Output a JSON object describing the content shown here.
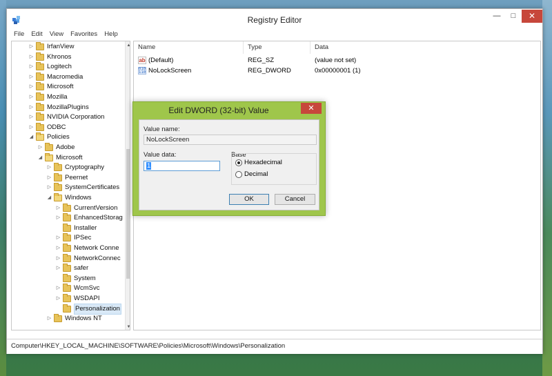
{
  "window": {
    "title": "Registry Editor",
    "controls": {
      "minimize": "—",
      "maximize": "□",
      "close": "✕"
    }
  },
  "menu": [
    "File",
    "Edit",
    "View",
    "Favorites",
    "Help"
  ],
  "tree": [
    {
      "label": "IrfanView",
      "indent": 1,
      "expander": "▷"
    },
    {
      "label": "Khronos",
      "indent": 1,
      "expander": "▷"
    },
    {
      "label": "Logitech",
      "indent": 1,
      "expander": "▷"
    },
    {
      "label": "Macromedia",
      "indent": 1,
      "expander": "▷"
    },
    {
      "label": "Microsoft",
      "indent": 1,
      "expander": "▷"
    },
    {
      "label": "Mozilla",
      "indent": 1,
      "expander": "▷"
    },
    {
      "label": "MozillaPlugins",
      "indent": 1,
      "expander": "▷"
    },
    {
      "label": "NVIDIA Corporation",
      "indent": 1,
      "expander": "▷"
    },
    {
      "label": "ODBC",
      "indent": 1,
      "expander": "▷"
    },
    {
      "label": "Policies",
      "indent": 1,
      "expander": "◢"
    },
    {
      "label": "Adobe",
      "indent": 2,
      "expander": "▷"
    },
    {
      "label": "Microsoft",
      "indent": 2,
      "expander": "◢"
    },
    {
      "label": "Cryptography",
      "indent": 3,
      "expander": "▷"
    },
    {
      "label": "Peernet",
      "indent": 3,
      "expander": "▷"
    },
    {
      "label": "SystemCertificates",
      "indent": 3,
      "expander": "▷"
    },
    {
      "label": "Windows",
      "indent": 3,
      "expander": "◢"
    },
    {
      "label": "CurrentVersion",
      "indent": 4,
      "expander": "▷"
    },
    {
      "label": "EnhancedStorag",
      "indent": 4,
      "expander": "▷"
    },
    {
      "label": "Installer",
      "indent": 4,
      "expander": ""
    },
    {
      "label": "IPSec",
      "indent": 4,
      "expander": "▷"
    },
    {
      "label": "Network Conne",
      "indent": 4,
      "expander": "▷"
    },
    {
      "label": "NetworkConnec",
      "indent": 4,
      "expander": "▷"
    },
    {
      "label": "safer",
      "indent": 4,
      "expander": "▷"
    },
    {
      "label": "System",
      "indent": 4,
      "expander": ""
    },
    {
      "label": "WcmSvc",
      "indent": 4,
      "expander": "▷"
    },
    {
      "label": "WSDAPI",
      "indent": 4,
      "expander": "▷"
    },
    {
      "label": "Personalization",
      "indent": 4,
      "expander": "",
      "selected": true
    },
    {
      "label": "Windows NT",
      "indent": 3,
      "expander": "▷"
    }
  ],
  "list": {
    "columns": [
      "Name",
      "Type",
      "Data"
    ],
    "rows": [
      {
        "icon": "ab",
        "name": "(Default)",
        "type": "REG_SZ",
        "data": "(value not set)"
      },
      {
        "icon": "bin",
        "name": "NoLockScreen",
        "type": "REG_DWORD",
        "data": "0x00000001 (1)"
      }
    ]
  },
  "status": {
    "path": "Computer\\HKEY_LOCAL_MACHINE\\SOFTWARE\\Policies\\Microsoft\\Windows\\Personalization"
  },
  "dialog": {
    "title": "Edit DWORD (32-bit) Value",
    "close": "✕",
    "value_name_label": "Value name:",
    "value_name": "NoLockScreen",
    "value_data_label": "Value data:",
    "value_data": "1",
    "base_label": "Base",
    "base_options": [
      {
        "label": "Hexadecimal",
        "checked": true
      },
      {
        "label": "Decimal",
        "checked": false
      }
    ],
    "ok_label": "OK",
    "cancel_label": "Cancel"
  },
  "colors": {
    "dialog_frame": "#9fc64b",
    "close_button": "#c7473b",
    "selection": "#3390ff"
  },
  "icons": [
    "registry-editor-icon",
    "string-value-icon",
    "binary-value-icon",
    "folder-icon"
  ]
}
